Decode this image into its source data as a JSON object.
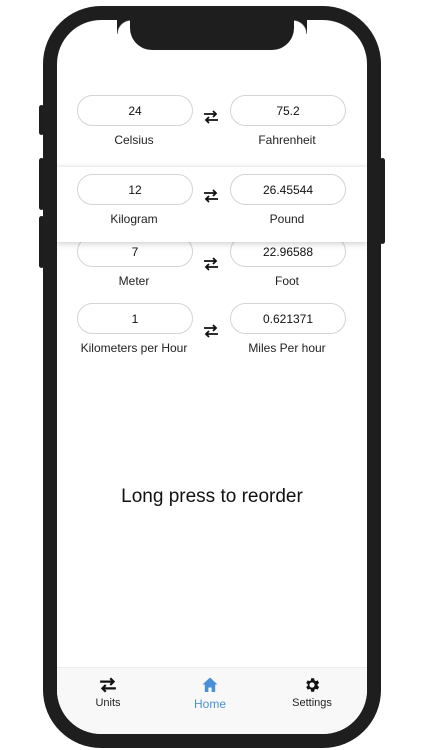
{
  "conversions": [
    {
      "left_value": "24",
      "left_unit": "Celsius",
      "right_value": "75.2",
      "right_unit": "Fahrenheit"
    },
    {
      "left_value": "12",
      "left_unit": "Kilogram",
      "right_value": "26.45544",
      "right_unit": "Pound"
    },
    {
      "left_value": "7",
      "left_unit": "Meter",
      "right_value": "22.96588",
      "right_unit": "Foot"
    },
    {
      "left_value": "1",
      "left_unit": "Kilometers per Hour",
      "right_value": "0.621371",
      "right_unit": "Miles Per hour"
    }
  ],
  "hint": "Long press to reorder",
  "nav": {
    "items": [
      {
        "label": "Units",
        "icon": "swap-icon"
      },
      {
        "label": "Home",
        "icon": "home-icon"
      },
      {
        "label": "Settings",
        "icon": "gear-icon"
      }
    ],
    "active": "Home"
  },
  "colors": {
    "accent": "#4a90d9",
    "frame": "#1e1e1e"
  }
}
